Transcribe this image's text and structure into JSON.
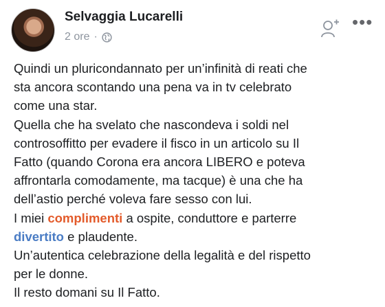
{
  "post": {
    "author": "Selvaggia Lucarelli",
    "time": "2 ore",
    "separator": "·",
    "privacy_icon": "globe-icon",
    "follow_icon": "add-friend-icon",
    "more_icon": "more-options-icon",
    "more_symbol": "•••",
    "text": {
      "line1": "Quindi un pluricondannato per un’infinità di reati che",
      "line2": "sta ancora scontando una pena va in tv celebrato",
      "line3": "come una star.",
      "line4": "Quella che ha svelato che nascondeva i soldi nel",
      "line5": "controsoffitto per evadere il fisco in un articolo su Il",
      "line6": "Fatto (quando Corona era ancora LIBERO e poteva",
      "line7": "affrontarla comodamente, ma tacque) è una che ha",
      "line8": "dell’astio perché voleva fare sesso con lui.",
      "line9_a": "I miei ",
      "line9_highlight": "complimenti",
      "line9_b": " a ospite, conduttore e parterre",
      "line10_highlight": "divertito",
      "line10_b": " e plaudente.",
      "line11": "Un’autentica celebrazione della legalità e del rispetto",
      "line12": "per le donne.",
      "line13": "Il resto domani su Il Fatto."
    }
  }
}
